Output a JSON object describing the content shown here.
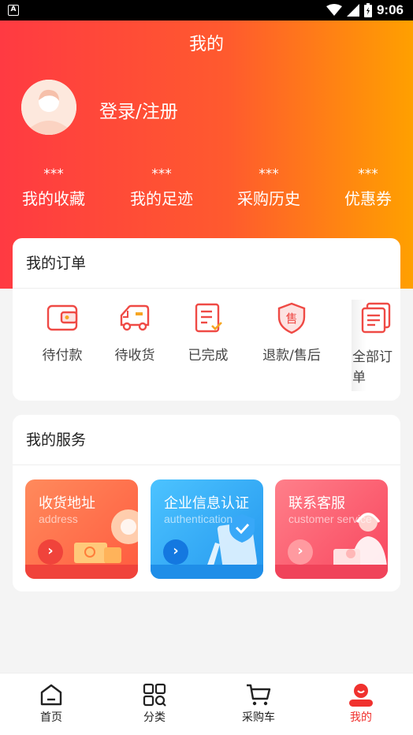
{
  "status_bar": {
    "time": "9:06",
    "a_label": "A"
  },
  "header": {
    "title": "我的"
  },
  "profile": {
    "login_label": "登录/注册"
  },
  "stats": [
    {
      "value": "***",
      "label": "我的收藏"
    },
    {
      "value": "***",
      "label": "我的足迹"
    },
    {
      "value": "***",
      "label": "采购历史"
    },
    {
      "value": "***",
      "label": "优惠券"
    }
  ],
  "orders": {
    "title": "我的订单",
    "items": [
      {
        "label": "待付款",
        "icon": "wallet-icon"
      },
      {
        "label": "待收货",
        "icon": "truck-icon"
      },
      {
        "label": "已完成",
        "icon": "completed-doc-icon"
      },
      {
        "label": "退款/售后",
        "icon": "after-sales-shield-icon"
      }
    ],
    "all_label": "全部订单",
    "all_icon": "order-list-icon"
  },
  "services": {
    "title": "我的服务",
    "items": [
      {
        "title": "收货地址",
        "subtitle": "address",
        "color": "#ff6f4b"
      },
      {
        "title": "企业信息认证",
        "subtitle": "authentication",
        "color": "#2ea8f3"
      },
      {
        "title": "联系客服",
        "subtitle": "customer service",
        "color": "#fb5a6e"
      }
    ]
  },
  "tabbar": {
    "items": [
      {
        "label": "首页",
        "icon": "home-icon",
        "active": false
      },
      {
        "label": "分类",
        "icon": "category-grid-icon",
        "active": false
      },
      {
        "label": "采购车",
        "icon": "cart-icon",
        "active": false
      },
      {
        "label": "我的",
        "icon": "profile-icon",
        "active": true
      }
    ]
  },
  "colors": {
    "brand": "#ff3a42",
    "accent": "#ffa000",
    "active_tab": "#f0312e"
  }
}
